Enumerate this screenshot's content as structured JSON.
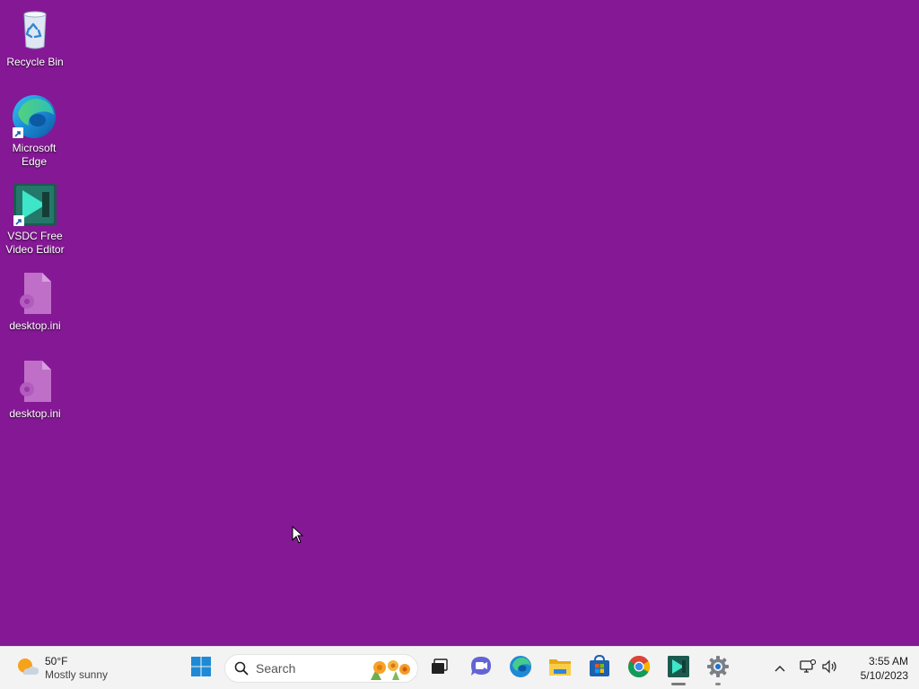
{
  "desktop": {
    "background": "#851995",
    "icons": [
      {
        "label": "Recycle Bin",
        "icon": "recycle-bin-icon"
      },
      {
        "label": "Microsoft Edge",
        "icon": "edge-icon"
      },
      {
        "label": "VSDC Free Video Editor",
        "icon": "vsdc-icon"
      },
      {
        "label": "desktop.ini",
        "icon": "settings-file-icon"
      },
      {
        "label": "desktop.ini",
        "icon": "settings-file-icon"
      }
    ]
  },
  "taskbar": {
    "weather": {
      "temp": "50°F",
      "condition": "Mostly sunny",
      "icon": "partly-sunny-icon"
    },
    "search": {
      "placeholder": "Search"
    },
    "apps": [
      {
        "name": "Start",
        "icon": "windows-start-icon"
      },
      {
        "name": "Task View",
        "icon": "task-view-icon"
      },
      {
        "name": "Chat",
        "icon": "chat-icon"
      },
      {
        "name": "Microsoft Edge",
        "icon": "edge-icon"
      },
      {
        "name": "File Explorer",
        "icon": "folder-icon"
      },
      {
        "name": "Microsoft Store",
        "icon": "store-icon"
      },
      {
        "name": "Google Chrome",
        "icon": "chrome-icon"
      },
      {
        "name": "VSDC Free Video Editor",
        "icon": "vsdc-icon",
        "running": true
      },
      {
        "name": "Settings",
        "icon": "gear-icon",
        "running": true
      }
    ],
    "clock": {
      "time": "3:55 AM",
      "date": "5/10/2023"
    }
  }
}
